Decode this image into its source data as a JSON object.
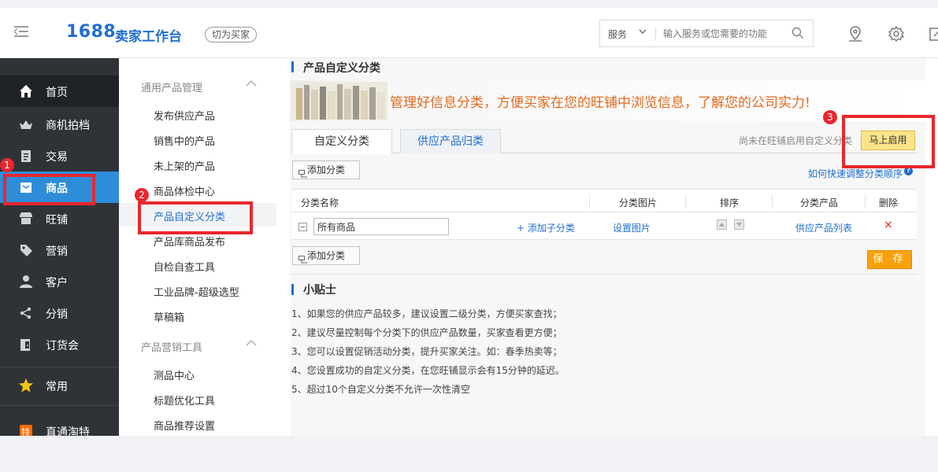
{
  "topbar": {
    "logo": "1688",
    "logo_sub": "卖家工作台",
    "switch_label": "切为买家",
    "search_category": "服务",
    "search_placeholder": "输入服务或您需要的功能"
  },
  "nav": {
    "items": [
      {
        "label": "首页",
        "icon": "home-icon"
      },
      {
        "label": "商机拍档",
        "icon": "crown-icon"
      },
      {
        "label": "交易",
        "icon": "clipboard-icon"
      },
      {
        "label": "商品",
        "icon": "box-icon"
      },
      {
        "label": "旺铺",
        "icon": "store-icon"
      },
      {
        "label": "营销",
        "icon": "tag-icon"
      },
      {
        "label": "客户",
        "icon": "user-icon"
      },
      {
        "label": "分销",
        "icon": "share-icon"
      },
      {
        "label": "订货会",
        "icon": "door-icon"
      },
      {
        "label": "常用",
        "icon": "star-icon"
      },
      {
        "label": "直通淘特",
        "icon": "special-icon"
      }
    ]
  },
  "subnav": {
    "group1": "通用产品管理",
    "group1_items": [
      "发布供应产品",
      "销售中的产品",
      "未上架的产品",
      "商品体检中心",
      "产品自定义分类",
      "产品库商品发布",
      "自检自查工具",
      "工业品牌-超级选型",
      "草稿箱"
    ],
    "group2": "产品营销工具",
    "group2_items": [
      "测品中心",
      "标题优化工具",
      "商品推荐设置"
    ]
  },
  "main": {
    "title": "产品自定义分类",
    "banner_text": "管理好信息分类，方便买家在您的旺铺中浏览信息，了解您的公司实力!",
    "tab1": "自定义分类",
    "tab2": "供应产品归类",
    "unactivated_text": "尚未在旺铺启用自定义分类",
    "enable_button": "马上启用",
    "add_category": "添加分类",
    "help_link": "如何快速调整分类顺序",
    "table": {
      "headers": [
        "分类名称",
        "分类图片",
        "排序",
        "分类产品",
        "删除"
      ],
      "row": {
        "name": "所有商品",
        "add_sub": "+ 添加子分类",
        "set_image": "设置图片",
        "product_list": "供应产品列表",
        "delete": "×"
      }
    },
    "save_button": "保 存",
    "tips_title": "小贴士",
    "tips": [
      "1、如果您的供应产品较多，建议设置二级分类，方便买家查找；",
      "2、建议尽量控制每个分类下的供应产品数量，买家查看更方便；",
      "3、您可以设置促销活动分类，提升买家关注。如：春季热卖等；",
      "4、您设置成功的自定义分类，在您旺铺显示会有15分钟的延迟。",
      "5、超过10个自定义分类不允许一次性清空"
    ]
  },
  "annotations": {
    "badge1": "1",
    "badge2": "2",
    "badge3": "3"
  },
  "colors": {
    "accent": "#1f6fd0",
    "nav_bg": "#2f3338",
    "nav_active": "#2e8cd8",
    "marker": "#e8272e",
    "banner_text": "#e46a1d"
  }
}
